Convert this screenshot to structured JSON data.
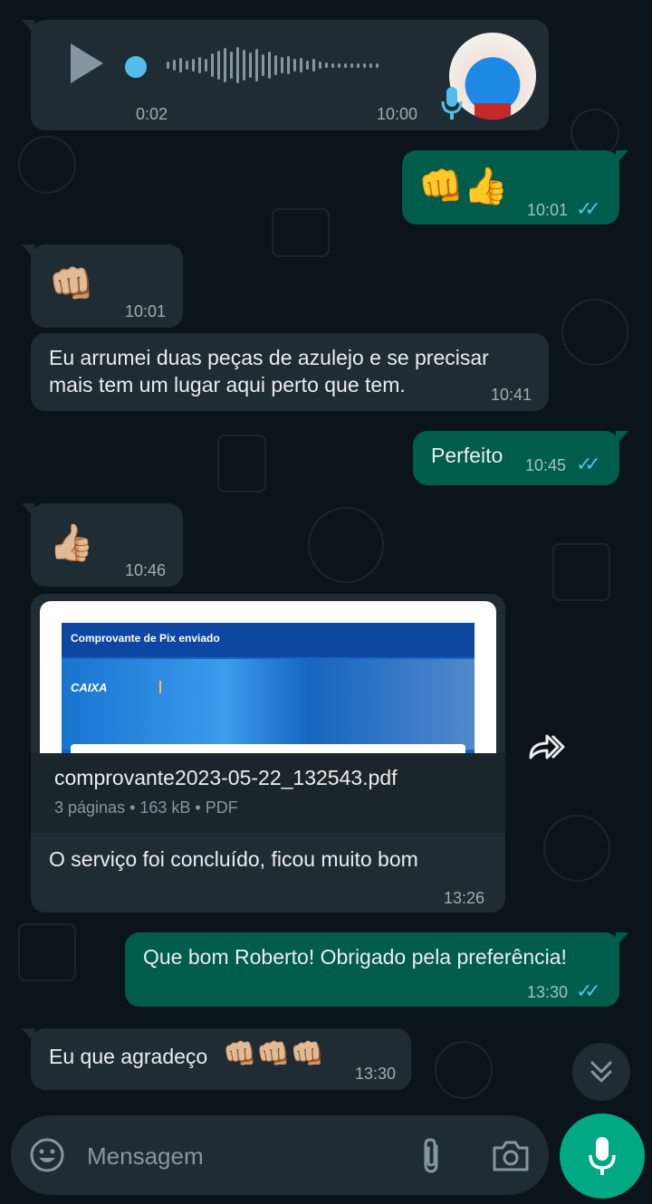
{
  "voice_message": {
    "elapsed": "0:02",
    "time": "10:00"
  },
  "messages": [
    {
      "id": "m1",
      "direction": "out",
      "emoji": "👊👍",
      "time": "10:01"
    },
    {
      "id": "m2",
      "direction": "in",
      "emoji": "👊🏼",
      "time": "10:01"
    },
    {
      "id": "m3",
      "direction": "in",
      "text": "Eu arrumei duas peças de azulejo e se precisar mais tem um lugar aqui perto que tem.",
      "time": "10:41"
    },
    {
      "id": "m4",
      "direction": "out",
      "text": "Perfeito",
      "time": "10:45"
    },
    {
      "id": "m5",
      "direction": "in",
      "emoji": "👍🏼",
      "time": "10:46"
    },
    {
      "id": "m6",
      "direction": "in",
      "text": "O serviço foi concluído, ficou muito bom",
      "time": "13:26"
    },
    {
      "id": "m7",
      "direction": "out",
      "text": "Que bom Roberto! Obrigado pela preferência!",
      "time": "13:30"
    },
    {
      "id": "m8",
      "direction": "in",
      "text": "Eu que agradeço",
      "emoji": "👊🏼👊🏼👊🏼",
      "time": "13:30"
    }
  ],
  "document": {
    "preview_title": "Comprovante de Pix enviado",
    "preview_brand": "CAIXA",
    "file_name": "comprovante2023-05-22_132543.pdf",
    "meta": "3 páginas • 163 kB • PDF"
  },
  "composer": {
    "placeholder": "Mensagem"
  },
  "colors": {
    "incoming": "#202c33",
    "outgoing": "#005c4b",
    "read_ticks": "#53bdeb",
    "accent": "#00a884",
    "background": "#0b141a"
  }
}
